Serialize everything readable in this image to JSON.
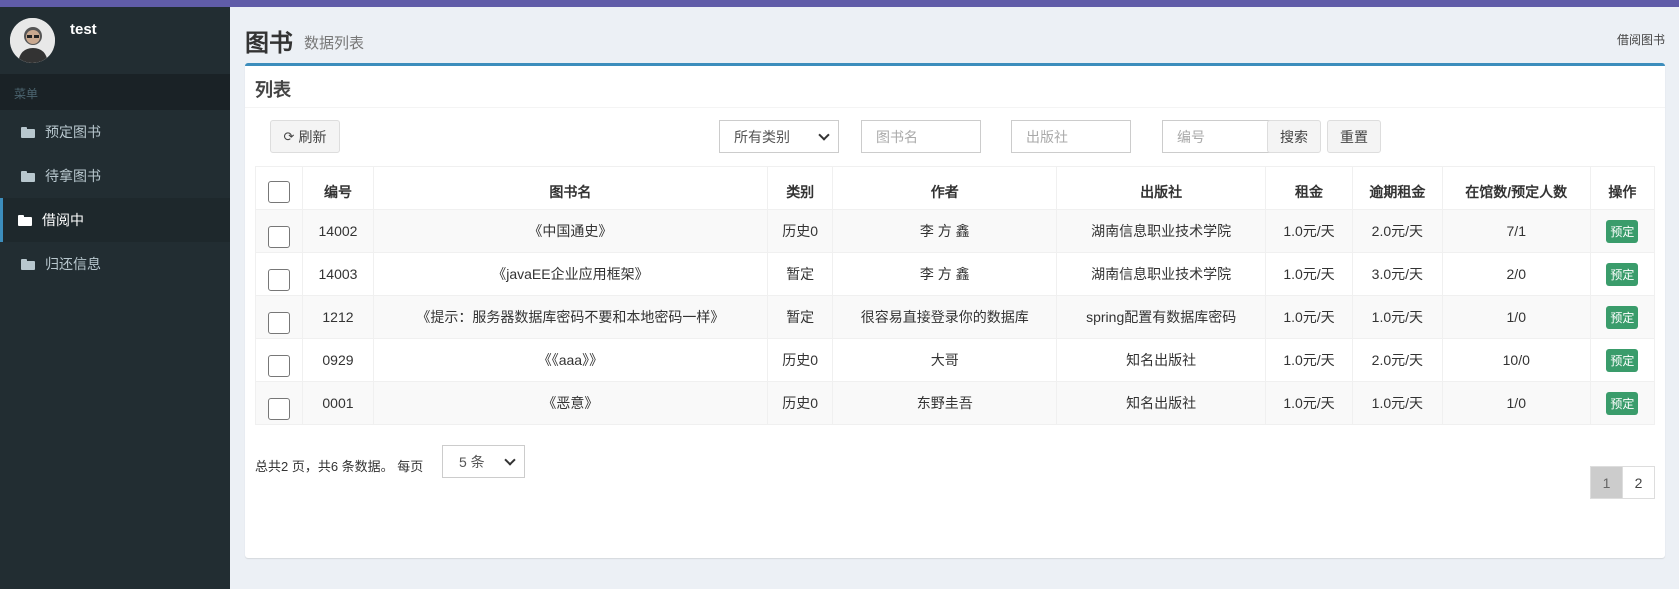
{
  "user": {
    "name": "test"
  },
  "sidebar": {
    "header": "菜单",
    "items": [
      {
        "label": "预定图书",
        "active": false
      },
      {
        "label": "待拿图书",
        "active": false
      },
      {
        "label": "借阅中",
        "active": true
      },
      {
        "label": "归还信息",
        "active": false
      }
    ]
  },
  "page": {
    "title": "图书",
    "subtitle": "数据列表",
    "breadcrumb": "借阅图书"
  },
  "box": {
    "title": "列表"
  },
  "toolbar": {
    "refresh_label": "刷新",
    "category_value": "所有类别",
    "name_placeholder": "图书名",
    "publisher_placeholder": "出版社",
    "number_placeholder": "编号",
    "search_label": "搜索",
    "reset_label": "重置"
  },
  "table": {
    "headers": [
      "编号",
      "图书名",
      "类别",
      "作者",
      "出版社",
      "租金",
      "逾期租金",
      "在馆数/预定人数",
      "操作"
    ],
    "rows": [
      {
        "id": "14002",
        "name": "《中国通史》",
        "category": "历史0",
        "author": "李 方 鑫",
        "publisher": "湖南信息职业技术学院",
        "rent": "1.0元/天",
        "overdue": "2.0元/天",
        "stock": "7/1",
        "action": "预定"
      },
      {
        "id": "14003",
        "name": "《javaEE企业应用框架》",
        "category": "暂定",
        "author": "李 方 鑫",
        "publisher": "湖南信息职业技术学院",
        "rent": "1.0元/天",
        "overdue": "3.0元/天",
        "stock": "2/0",
        "action": "预定"
      },
      {
        "id": "1212",
        "name": "《提示：服务器数据库密码不要和本地密码一样》",
        "category": "暂定",
        "author": "很容易直接登录你的数据库",
        "publisher": "spring配置有数据库密码",
        "rent": "1.0元/天",
        "overdue": "1.0元/天",
        "stock": "1/0",
        "action": "预定"
      },
      {
        "id": "0929",
        "name": "《《aaa》》",
        "category": "历史0",
        "author": "大哥",
        "publisher": "知名出版社",
        "rent": "1.0元/天",
        "overdue": "2.0元/天",
        "stock": "10/0",
        "action": "预定"
      },
      {
        "id": "0001",
        "name": "《恶意》",
        "category": "历史0",
        "author": "东野圭吾",
        "publisher": "知名出版社",
        "rent": "1.0元/天",
        "overdue": "1.0元/天",
        "stock": "1/0",
        "action": "预定"
      }
    ]
  },
  "footer": {
    "summary": "总共2 页，共6 条数据。 每页",
    "page_size": "5 条",
    "pages": [
      "1",
      "2"
    ],
    "current_page": "1"
  },
  "colors": {
    "topbar": "#605ca8",
    "sidebar_bg": "#222d32",
    "box_accent": "#3c8dbc",
    "tag_green": "#3a9c6b"
  }
}
